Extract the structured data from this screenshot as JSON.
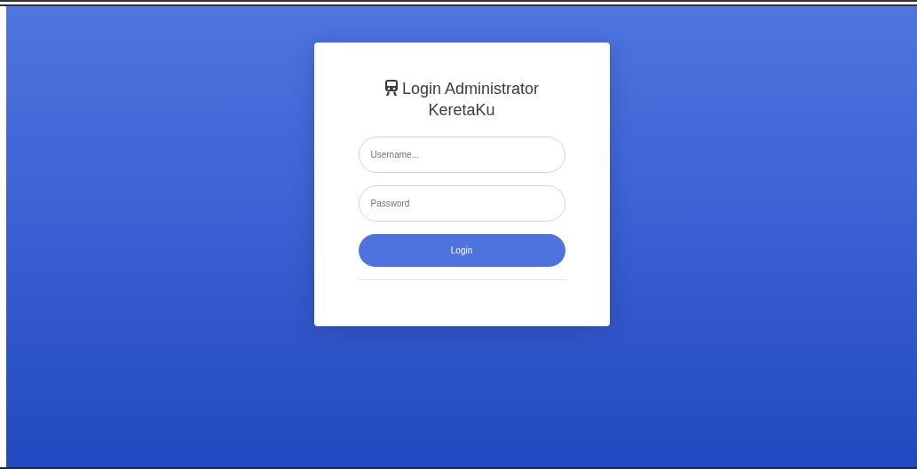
{
  "login_card": {
    "title": "Login Administrator KeretaKu",
    "username_field": {
      "placeholder": "Username..."
    },
    "password_field": {
      "placeholder": "Password"
    },
    "login_button": {
      "label": "Login"
    }
  }
}
